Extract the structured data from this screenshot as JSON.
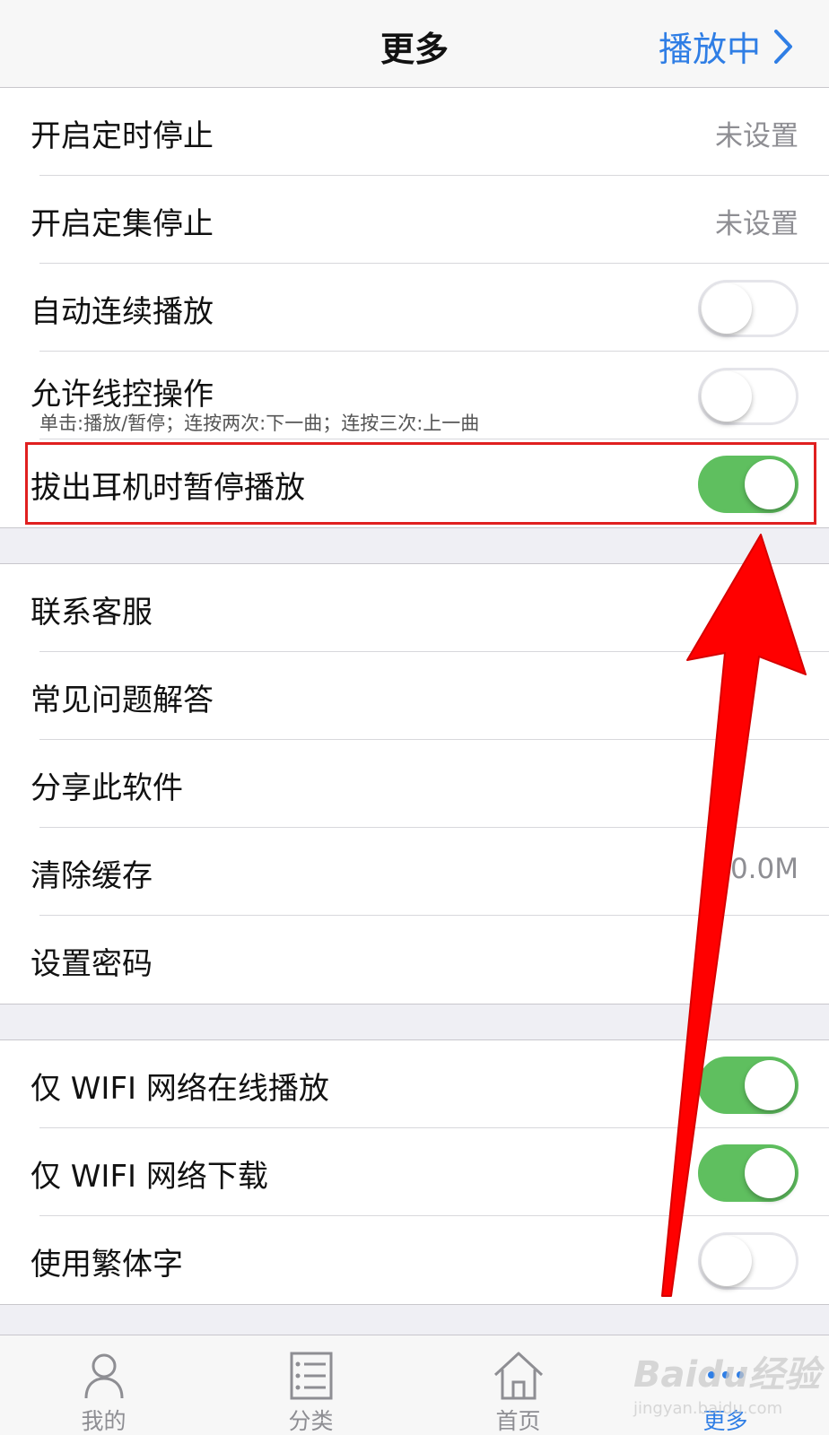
{
  "navbar": {
    "title": "更多",
    "right_label": "播放中"
  },
  "group1": [
    {
      "label": "开启定时停止",
      "value": "未设置"
    },
    {
      "label": "开启定集停止",
      "value": "未设置"
    },
    {
      "label": "自动连续播放",
      "toggle": false
    },
    {
      "label": "允许线控操作",
      "sublabel": "单击:播放/暂停；连按两次:下一曲；连按三次:上一曲",
      "toggle": false
    },
    {
      "label": "拔出耳机时暂停播放",
      "toggle": true
    }
  ],
  "group2": [
    {
      "label": "联系客服"
    },
    {
      "label": "常见问题解答"
    },
    {
      "label": "分享此软件"
    },
    {
      "label": "清除缓存",
      "value": "0.0M"
    },
    {
      "label": "设置密码"
    }
  ],
  "group3": [
    {
      "label": "仅 WIFI 网络在线播放",
      "toggle": true
    },
    {
      "label": "仅 WIFI 网络下载",
      "toggle": true
    },
    {
      "label": "使用繁体字",
      "toggle": false
    }
  ],
  "tabs": [
    {
      "label": "我的",
      "icon": "person-icon"
    },
    {
      "label": "分类",
      "icon": "list-icon"
    },
    {
      "label": "首页",
      "icon": "home-icon"
    },
    {
      "label": "更多",
      "icon": "more-icon",
      "active": true
    }
  ],
  "watermark": {
    "main": "Baidu经验",
    "sub": "jingyan.baidu.com"
  },
  "colors": {
    "accent": "#2f7ee5",
    "toggle_on": "#5fbf5f",
    "highlight": "#e02020",
    "arrow": "#ff0000"
  }
}
